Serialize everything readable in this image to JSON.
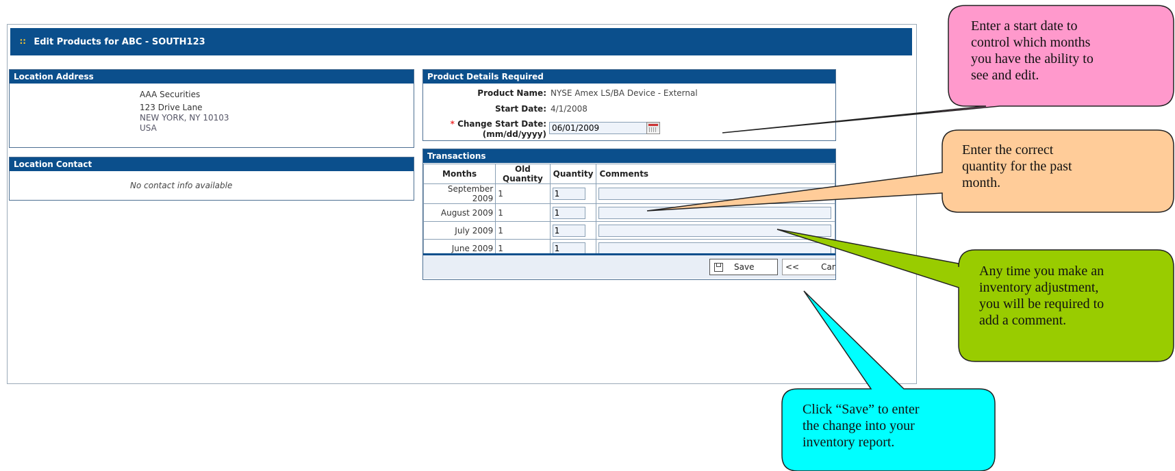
{
  "header": {
    "title": "Edit Products for ABC - SOUTH123",
    "icon": "grid-icon",
    "color": "#0b4f8c"
  },
  "location_address": {
    "heading": "Location Address",
    "lines": [
      "AAA Securities",
      "123 Drive Lane",
      "NEW YORK, NY 10103",
      "USA"
    ]
  },
  "location_contact": {
    "heading": "Location Contact",
    "message": "No contact info available"
  },
  "product_details": {
    "heading": "Product Details Required",
    "product_name_label": "Product Name:",
    "product_name": "NYSE Amex LS/BA Device - External",
    "start_date_label": "Start Date:",
    "start_date": "4/1/2008",
    "required_marker": "*",
    "change_start_label": "Change Start Date:",
    "change_start_format": "(mm/dd/yyyy)",
    "change_start_value": "06/01/2009"
  },
  "transactions": {
    "heading": "Transactions",
    "columns": [
      "Months",
      "Old Quantity",
      "Quantity",
      "Comments"
    ],
    "rows": [
      {
        "month": "September 2009",
        "old_quantity": "1",
        "quantity": "1",
        "comment": ""
      },
      {
        "month": "August 2009",
        "old_quantity": "1",
        "quantity": "1",
        "comment": ""
      },
      {
        "month": "July 2009",
        "old_quantity": "1",
        "quantity": "1",
        "comment": ""
      },
      {
        "month": "June 2009",
        "old_quantity": "1",
        "quantity": "1",
        "comment": ""
      }
    ],
    "save_label": "Save",
    "cancel_prefix": "<<",
    "cancel_label": "Cancel"
  },
  "callouts": {
    "start_date": {
      "lines": [
        "Enter a start date to",
        "control which months",
        "you have the ability to",
        "see and edit."
      ],
      "color": "#ff99cc"
    },
    "quantity": {
      "lines": [
        "Enter the correct",
        "quantity for the past",
        "month."
      ],
      "color": "#ffcc99"
    },
    "comment": {
      "lines": [
        "Any time you make an",
        "inventory adjustment,",
        "you will be required to",
        "add a comment."
      ],
      "color": "#99cc00"
    },
    "save": {
      "lines": [
        "Click “Save” to enter",
        "the change into your",
        "inventory report."
      ],
      "color": "#00ffff"
    }
  }
}
